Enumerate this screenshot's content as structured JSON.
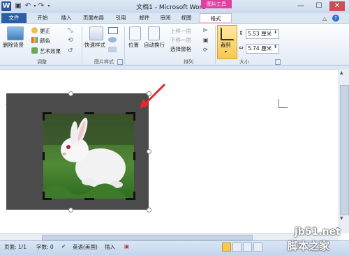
{
  "app": {
    "title": "文档1 - Microsoft Word",
    "logo_letter": "W",
    "picture_tools": "图片工具"
  },
  "window_controls": {
    "minimize": "—",
    "maximize": "☐",
    "close": "✕"
  },
  "tabs": [
    "文件",
    "开始",
    "插入",
    "页面布局",
    "引用",
    "邮件",
    "审阅",
    "视图",
    "格式"
  ],
  "ribbon": {
    "adjust": {
      "remove_bg": "删除背景",
      "corrections": "更正",
      "color": "颜色",
      "artistic": "艺术效果",
      "label": "调整"
    },
    "picture_styles": {
      "quick_styles": "快速样式",
      "label": "图片样式"
    },
    "arrange": {
      "position": "位置",
      "wrap_text": "自动换行",
      "bring_forward": "上移一层",
      "send_backward": "下移一层",
      "selection_pane": "选择窗格",
      "label": "排列"
    },
    "size": {
      "crop": "裁剪",
      "height": "5.53 厘米",
      "width": "5.74 厘米",
      "label": "大小"
    }
  },
  "status": {
    "page": "页面: 1/1",
    "words": "字数: 0",
    "language": "英语(美国)",
    "mode": "插入"
  },
  "watermark": {
    "site": "jb51.net",
    "cn": "脚本之家"
  },
  "colors": {
    "file_tab": "#2a5ea9",
    "picture_tools": "#e23fa0",
    "arrow": "#e8272b"
  }
}
